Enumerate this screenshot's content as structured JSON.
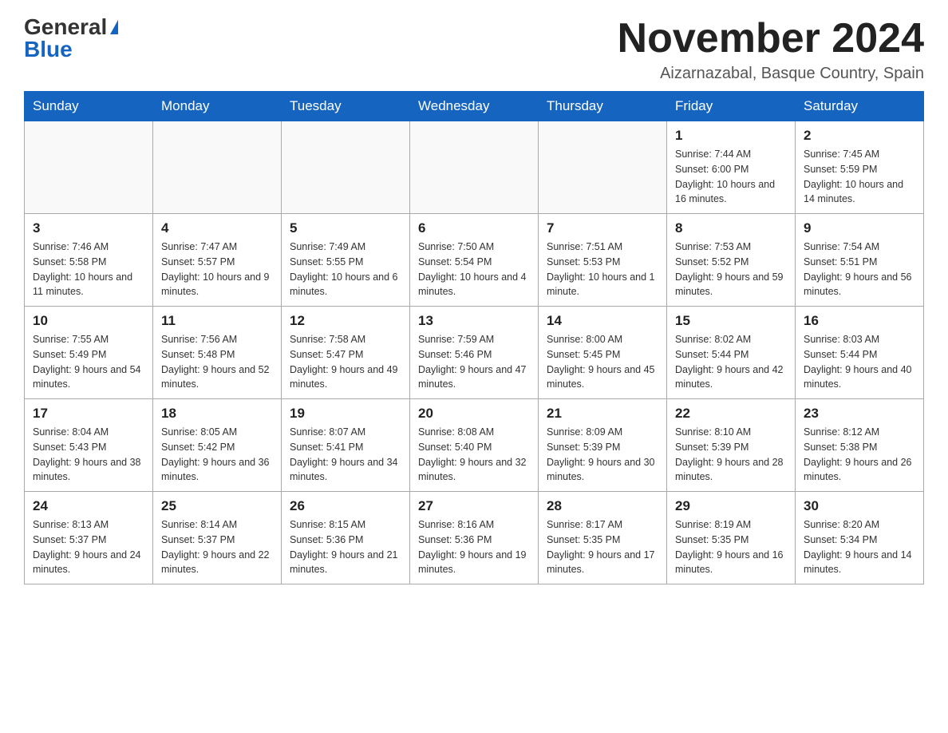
{
  "header": {
    "logo_general": "General",
    "logo_blue": "Blue",
    "month_title": "November 2024",
    "location": "Aizarnazabal, Basque Country, Spain"
  },
  "days_of_week": [
    "Sunday",
    "Monday",
    "Tuesday",
    "Wednesday",
    "Thursday",
    "Friday",
    "Saturday"
  ],
  "weeks": [
    [
      {
        "day": "",
        "sunrise": "",
        "sunset": "",
        "daylight": ""
      },
      {
        "day": "",
        "sunrise": "",
        "sunset": "",
        "daylight": ""
      },
      {
        "day": "",
        "sunrise": "",
        "sunset": "",
        "daylight": ""
      },
      {
        "day": "",
        "sunrise": "",
        "sunset": "",
        "daylight": ""
      },
      {
        "day": "",
        "sunrise": "",
        "sunset": "",
        "daylight": ""
      },
      {
        "day": "1",
        "sunrise": "Sunrise: 7:44 AM",
        "sunset": "Sunset: 6:00 PM",
        "daylight": "Daylight: 10 hours and 16 minutes."
      },
      {
        "day": "2",
        "sunrise": "Sunrise: 7:45 AM",
        "sunset": "Sunset: 5:59 PM",
        "daylight": "Daylight: 10 hours and 14 minutes."
      }
    ],
    [
      {
        "day": "3",
        "sunrise": "Sunrise: 7:46 AM",
        "sunset": "Sunset: 5:58 PM",
        "daylight": "Daylight: 10 hours and 11 minutes."
      },
      {
        "day": "4",
        "sunrise": "Sunrise: 7:47 AM",
        "sunset": "Sunset: 5:57 PM",
        "daylight": "Daylight: 10 hours and 9 minutes."
      },
      {
        "day": "5",
        "sunrise": "Sunrise: 7:49 AM",
        "sunset": "Sunset: 5:55 PM",
        "daylight": "Daylight: 10 hours and 6 minutes."
      },
      {
        "day": "6",
        "sunrise": "Sunrise: 7:50 AM",
        "sunset": "Sunset: 5:54 PM",
        "daylight": "Daylight: 10 hours and 4 minutes."
      },
      {
        "day": "7",
        "sunrise": "Sunrise: 7:51 AM",
        "sunset": "Sunset: 5:53 PM",
        "daylight": "Daylight: 10 hours and 1 minute."
      },
      {
        "day": "8",
        "sunrise": "Sunrise: 7:53 AM",
        "sunset": "Sunset: 5:52 PM",
        "daylight": "Daylight: 9 hours and 59 minutes."
      },
      {
        "day": "9",
        "sunrise": "Sunrise: 7:54 AM",
        "sunset": "Sunset: 5:51 PM",
        "daylight": "Daylight: 9 hours and 56 minutes."
      }
    ],
    [
      {
        "day": "10",
        "sunrise": "Sunrise: 7:55 AM",
        "sunset": "Sunset: 5:49 PM",
        "daylight": "Daylight: 9 hours and 54 minutes."
      },
      {
        "day": "11",
        "sunrise": "Sunrise: 7:56 AM",
        "sunset": "Sunset: 5:48 PM",
        "daylight": "Daylight: 9 hours and 52 minutes."
      },
      {
        "day": "12",
        "sunrise": "Sunrise: 7:58 AM",
        "sunset": "Sunset: 5:47 PM",
        "daylight": "Daylight: 9 hours and 49 minutes."
      },
      {
        "day": "13",
        "sunrise": "Sunrise: 7:59 AM",
        "sunset": "Sunset: 5:46 PM",
        "daylight": "Daylight: 9 hours and 47 minutes."
      },
      {
        "day": "14",
        "sunrise": "Sunrise: 8:00 AM",
        "sunset": "Sunset: 5:45 PM",
        "daylight": "Daylight: 9 hours and 45 minutes."
      },
      {
        "day": "15",
        "sunrise": "Sunrise: 8:02 AM",
        "sunset": "Sunset: 5:44 PM",
        "daylight": "Daylight: 9 hours and 42 minutes."
      },
      {
        "day": "16",
        "sunrise": "Sunrise: 8:03 AM",
        "sunset": "Sunset: 5:44 PM",
        "daylight": "Daylight: 9 hours and 40 minutes."
      }
    ],
    [
      {
        "day": "17",
        "sunrise": "Sunrise: 8:04 AM",
        "sunset": "Sunset: 5:43 PM",
        "daylight": "Daylight: 9 hours and 38 minutes."
      },
      {
        "day": "18",
        "sunrise": "Sunrise: 8:05 AM",
        "sunset": "Sunset: 5:42 PM",
        "daylight": "Daylight: 9 hours and 36 minutes."
      },
      {
        "day": "19",
        "sunrise": "Sunrise: 8:07 AM",
        "sunset": "Sunset: 5:41 PM",
        "daylight": "Daylight: 9 hours and 34 minutes."
      },
      {
        "day": "20",
        "sunrise": "Sunrise: 8:08 AM",
        "sunset": "Sunset: 5:40 PM",
        "daylight": "Daylight: 9 hours and 32 minutes."
      },
      {
        "day": "21",
        "sunrise": "Sunrise: 8:09 AM",
        "sunset": "Sunset: 5:39 PM",
        "daylight": "Daylight: 9 hours and 30 minutes."
      },
      {
        "day": "22",
        "sunrise": "Sunrise: 8:10 AM",
        "sunset": "Sunset: 5:39 PM",
        "daylight": "Daylight: 9 hours and 28 minutes."
      },
      {
        "day": "23",
        "sunrise": "Sunrise: 8:12 AM",
        "sunset": "Sunset: 5:38 PM",
        "daylight": "Daylight: 9 hours and 26 minutes."
      }
    ],
    [
      {
        "day": "24",
        "sunrise": "Sunrise: 8:13 AM",
        "sunset": "Sunset: 5:37 PM",
        "daylight": "Daylight: 9 hours and 24 minutes."
      },
      {
        "day": "25",
        "sunrise": "Sunrise: 8:14 AM",
        "sunset": "Sunset: 5:37 PM",
        "daylight": "Daylight: 9 hours and 22 minutes."
      },
      {
        "day": "26",
        "sunrise": "Sunrise: 8:15 AM",
        "sunset": "Sunset: 5:36 PM",
        "daylight": "Daylight: 9 hours and 21 minutes."
      },
      {
        "day": "27",
        "sunrise": "Sunrise: 8:16 AM",
        "sunset": "Sunset: 5:36 PM",
        "daylight": "Daylight: 9 hours and 19 minutes."
      },
      {
        "day": "28",
        "sunrise": "Sunrise: 8:17 AM",
        "sunset": "Sunset: 5:35 PM",
        "daylight": "Daylight: 9 hours and 17 minutes."
      },
      {
        "day": "29",
        "sunrise": "Sunrise: 8:19 AM",
        "sunset": "Sunset: 5:35 PM",
        "daylight": "Daylight: 9 hours and 16 minutes."
      },
      {
        "day": "30",
        "sunrise": "Sunrise: 8:20 AM",
        "sunset": "Sunset: 5:34 PM",
        "daylight": "Daylight: 9 hours and 14 minutes."
      }
    ]
  ]
}
